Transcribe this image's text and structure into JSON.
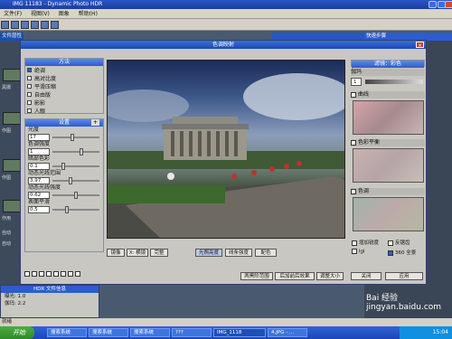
{
  "app": {
    "title": "IMG 11183 - Dynamic Photo HDR"
  },
  "menu": [
    "文件(F)",
    "视图(V)",
    "图象",
    "帮助(H)"
  ],
  "left_panel": {
    "title": "文件层性",
    "thumbs": [
      "黑摄",
      "作图",
      "作图",
      "作用",
      "自动",
      "自动"
    ]
  },
  "right_panel": {
    "title": "快速步骤"
  },
  "dialog": {
    "title": "色调映射",
    "method": {
      "header": "方法",
      "options": [
        "绝调",
        "高对比度",
        "平滑压缩",
        "自由版",
        "影影",
        "人眼"
      ],
      "checked": 0
    },
    "settings": {
      "header": "设置",
      "fields": [
        {
          "label": "光度",
          "value": "17"
        },
        {
          "label": "色调强度",
          "value": "1"
        },
        {
          "label": "暗部色彩",
          "value": "0.1"
        },
        {
          "label": "动态光线范围",
          "value": "3.97"
        },
        {
          "label": "动态光线强度",
          "value": "0.62"
        },
        {
          "label": "表面平滑",
          "value": "0.5"
        }
      ],
      "plus": "+"
    },
    "filter": {
      "header": "滤镜：彩色",
      "gamma_label": "伽玛",
      "gamma_value": "1",
      "curve_label": "曲线",
      "hue_label": "色彩平衡",
      "tint_label": "色调"
    },
    "checks": [
      {
        "label": "增加锐度",
        "checked": false
      },
      {
        "label": "反锯齿",
        "checked": false
      },
      {
        "label": "lgl",
        "checked": false
      },
      {
        "label": "360 全景",
        "checked": true
      }
    ],
    "bottom_buttons": [
      "镜像",
      "X: 横镜",
      "完整"
    ],
    "mode_buttons": [
      "光照亮度",
      "线条强度",
      "配色"
    ],
    "action_buttons": [
      "两黑阶范围",
      "后加前后效果",
      "调整大小",
      "关闭",
      "应用"
    ]
  },
  "bottom_panel": {
    "title": "HDR 文件信息",
    "lines": [
      "曝光: 1.0",
      "伽玛: 2.2"
    ]
  },
  "status": "就绪",
  "taskbar": {
    "start": "开始",
    "tasks": [
      "搜索系统",
      "搜索系统",
      "搜索系统",
      "???",
      "IMG_1118",
      "4.JPG - ..."
    ],
    "clock": "15:04"
  },
  "watermark": "Bai 经验 jingyan.baidu.com"
}
